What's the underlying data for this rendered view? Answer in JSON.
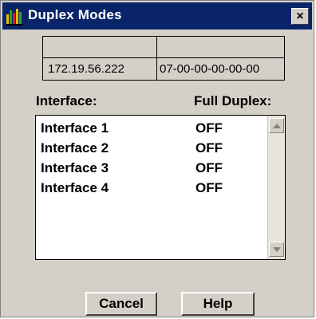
{
  "window": {
    "title": "Duplex Modes",
    "close_symbol": "×"
  },
  "grid": {
    "header_row": [
      "",
      ""
    ],
    "data_row": [
      "172.19.56.222",
      "07-00-00-00-00-00"
    ]
  },
  "labels": {
    "interface_header": "Interface:",
    "duplex_header": "Full Duplex:"
  },
  "interfaces": [
    {
      "name": "Interface 1",
      "state": "OFF"
    },
    {
      "name": "Interface 2",
      "state": "OFF"
    },
    {
      "name": "Interface 3",
      "state": "OFF"
    },
    {
      "name": "Interface 4",
      "state": "OFF"
    }
  ],
  "buttons": {
    "cancel": "Cancel",
    "help": "Help"
  },
  "icons": {
    "app": "app-chart-icon",
    "close": "close-icon",
    "scroll_up": "scroll-up-arrow-icon",
    "scroll_down": "scroll-down-arrow-icon"
  },
  "colors": {
    "title_bar": "#0a246a",
    "window_face": "#d4d0c8",
    "list_background": "#ffffff"
  }
}
